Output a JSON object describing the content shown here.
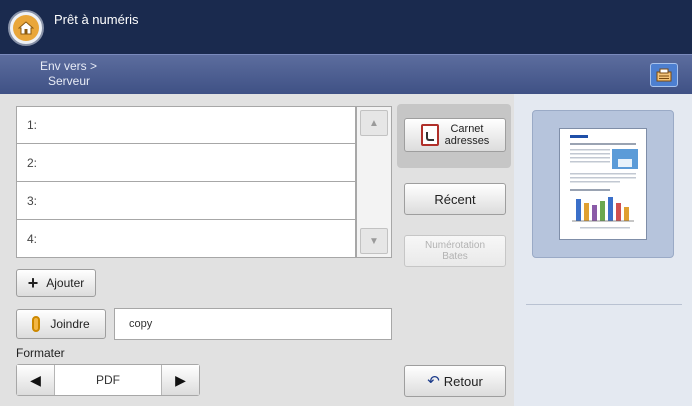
{
  "header": {
    "title": "Prêt à numéris",
    "home_icon": "home-icon",
    "job_icon": "job-status-icon"
  },
  "breadcrumb": {
    "line1": "Env vers >",
    "line2": "Serveur"
  },
  "destinations": [
    {
      "label": "1:"
    },
    {
      "label": "2:"
    },
    {
      "label": "3:"
    },
    {
      "label": "4:"
    }
  ],
  "scroll": {
    "up": "▲",
    "down": "▼"
  },
  "buttons": {
    "carnet_line1": "Carnet",
    "carnet_line2": "adresses",
    "recent": "Récent",
    "bates_line1": "Numérotation",
    "bates_line2": "Bates",
    "add": "Ajouter",
    "attach": "Joindre",
    "back": "Retour"
  },
  "attach_field": {
    "value": "copy"
  },
  "format": {
    "label": "Formater",
    "value": "PDF",
    "prev": "◀",
    "next": "▶"
  },
  "colors": {
    "topbar": "#1a2a4e",
    "subbar": "#4a5b90",
    "panel": "#e1e1e1",
    "preview": "#b6c4dc",
    "accent_blue": "#4d7fd0"
  }
}
